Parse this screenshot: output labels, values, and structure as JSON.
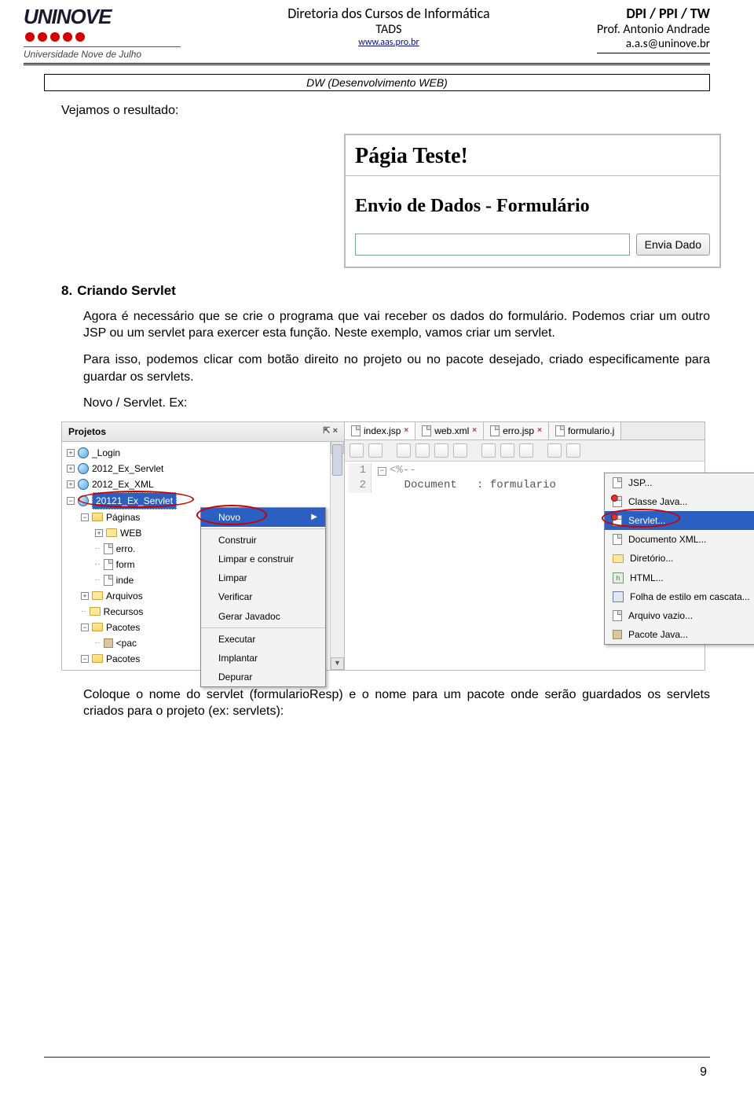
{
  "header": {
    "logo_text": "UNINOVE",
    "tagline": "Universidade Nove de Julho",
    "center_l1": "Diretoria dos Cursos de Informática",
    "center_l2": "TADS",
    "center_l3": "www.aas.pro.br",
    "right_l1": "DPI  / PPI / TW",
    "right_l2": "Prof. Antonio Andrade",
    "right_l3": "a.a.s@uninove.br",
    "course_box": "DW (Desenvolvimento WEB)"
  },
  "body": {
    "p1": "Vejamos o resultado:",
    "browser_title": "Págia Teste!",
    "browser_h2": "Envio de Dados - Formulário",
    "browser_button": "Envia Dado",
    "heading_num": "8.",
    "heading": "Criando Servlet",
    "p2": "Agora é necessário que se crie o programa que vai receber os dados do formulário. Podemos criar um outro JSP ou um servlet para exercer esta função. Neste exemplo, vamos criar um servlet.",
    "p3": "Para isso, podemos clicar com botão direito no projeto ou no pacote desejado, criado especificamente para guardar os servlets.",
    "p4": "Novo / Servlet. Ex:",
    "p5": "Coloque o nome do servlet (formularioResp) e o nome para um pacote onde serão guardados os servlets criados para o projeto (ex: servlets):"
  },
  "ide": {
    "panel_title": "Projetos",
    "pin": "⇱ ×",
    "projects": [
      "_Login",
      "2012_Ex_Servlet",
      "2012_Ex_XML"
    ],
    "selected_project": "20121_Ex_Servlet",
    "sub_folders": {
      "paginas": "Páginas",
      "web": "WEB",
      "erro": "erro.",
      "form": "form",
      "inde": "inde",
      "arquivos": "Arquivos",
      "recursos": "Recursos",
      "pacotes": "Pacotes",
      "pac": "<pac",
      "pacotes2": "Pacotes"
    },
    "tabs": [
      "index.jsp",
      "web.xml",
      "erro.jsp",
      "formulario.j"
    ],
    "code_line1_gutter": "1",
    "code_line1": "<%--",
    "code_line2_gutter": "2",
    "code_line2a": "Document",
    "code_line2b": ": formulario",
    "ctx1": [
      "Novo",
      "Construir",
      "Limpar e construir",
      "Limpar",
      "Verificar",
      "Gerar Javadoc",
      "Executar",
      "Implantar",
      "Depurar"
    ],
    "ctx2": [
      "JSP...",
      "Classe Java...",
      "Servlet...",
      "Documento XML...",
      "Diretório...",
      "HTML...",
      "Folha de estilo em cascata...",
      "Arquivo vazio...",
      "Pacote Java..."
    ]
  },
  "page_number": "9"
}
